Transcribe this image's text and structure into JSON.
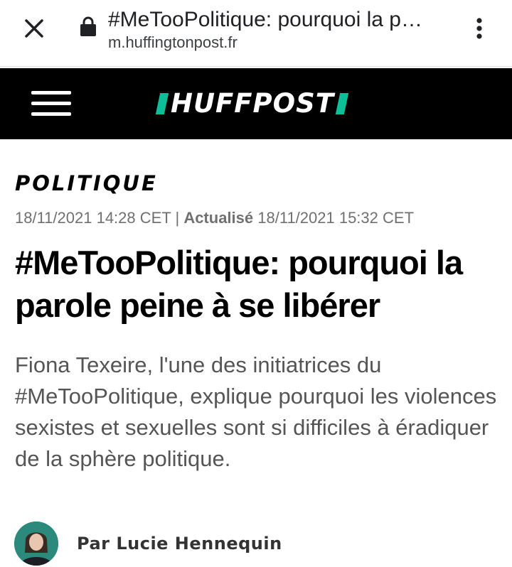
{
  "browser": {
    "tab_title": "#MeTooPolitique: pourquoi la p…",
    "url": "m.huffingtonpost.fr",
    "close_icon": "close-icon",
    "lock_icon": "lock-icon",
    "menu_icon": "more-vert-icon"
  },
  "header": {
    "logo_text": "HUFFPOST",
    "menu_icon": "hamburger-icon",
    "background": "#000000",
    "accent": "#0dbe98"
  },
  "article": {
    "section": "POLITIQUE",
    "published": "18/11/2021 14:28 CET",
    "separator": " | ",
    "updated_label": "Actualisé",
    "updated": " 18/11/2021 15:32 CET",
    "headline": "#MeTooPolitique: pourquoi la parole peine à se libérer",
    "dek": "Fiona Texeire, l'une des initiatrices du #MeTooPolitique, explique pourquoi les violences sexistes et sexuelles sont si difficiles à éradiquer de la sphère politique.",
    "author": "Par Lucie Hennequin"
  }
}
